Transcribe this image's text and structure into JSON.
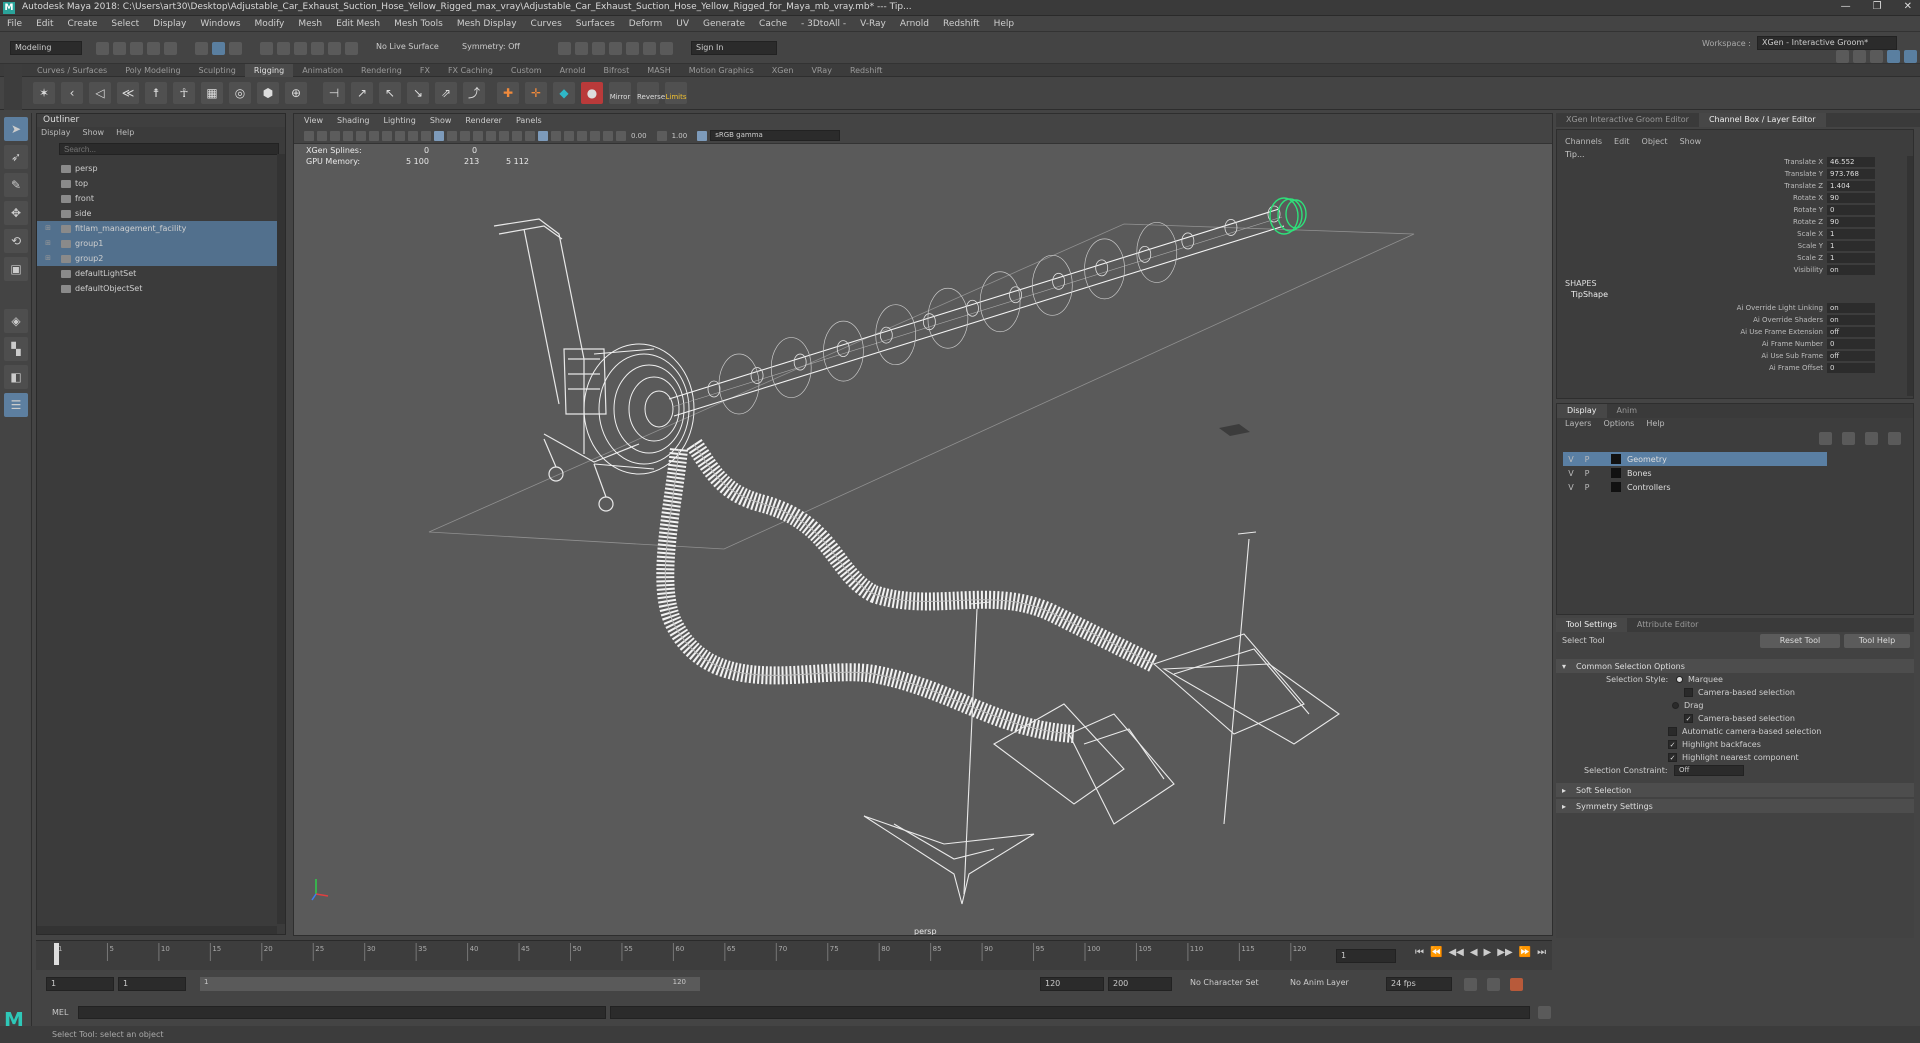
{
  "window": {
    "title": "Autodesk Maya 2018: C:\\Users\\art30\\Desktop\\Adjustable_Car_Exhaust_Suction_Hose_Yellow_Rigged_max_vray\\Adjustable_Car_Exhaust_Suction_Hose_Yellow_Rigged_for_Maya_mb_vray.mb*  ---  Tip...",
    "controls": [
      "—",
      "❐",
      "✕"
    ]
  },
  "menubar": [
    "File",
    "Edit",
    "Create",
    "Select",
    "Display",
    "Windows",
    "Modify",
    "Mesh",
    "Edit Mesh",
    "Mesh Tools",
    "Mesh Display",
    "Curves",
    "Surfaces",
    "Deform",
    "UV",
    "Generate",
    "Cache",
    "- 3DtoAll -",
    "V-Ray",
    "Arnold",
    "Redshift",
    "Help"
  ],
  "status": {
    "mode": "Modeling",
    "live_surface": "No Live Surface",
    "symmetry": "Symmetry: Off",
    "sign_in": "Sign In",
    "workspace_label": "Workspace :",
    "workspace": "XGen - Interactive Groom*"
  },
  "shelf_tabs": [
    "Curves / Surfaces",
    "Poly Modeling",
    "Sculpting",
    "Rigging",
    "Animation",
    "Rendering",
    "FX",
    "FX Caching",
    "Custom",
    "Arnold",
    "Bifrost",
    "MASH",
    "Motion Graphics",
    "XGen",
    "VRay",
    "Redshift"
  ],
  "shelf_active": "Rigging",
  "shelf_labels": {
    "mirror": "Mirror",
    "reverse": "Reverse",
    "limits": "Limits"
  },
  "outliner": {
    "title": "Outliner",
    "menu": [
      "Display",
      "Show",
      "Help"
    ],
    "search_placeholder": "Search...",
    "items": [
      {
        "label": "persp",
        "selected": false,
        "expand": ""
      },
      {
        "label": "top",
        "selected": false,
        "expand": ""
      },
      {
        "label": "front",
        "selected": false,
        "expand": ""
      },
      {
        "label": "side",
        "selected": false,
        "expand": ""
      },
      {
        "label": "fitlam_management_facility",
        "selected": true,
        "expand": "⊞"
      },
      {
        "label": "group1",
        "selected": true,
        "expand": "⊞"
      },
      {
        "label": "group2",
        "selected": true,
        "expand": "⊞"
      },
      {
        "label": "defaultLightSet",
        "selected": false,
        "expand": ""
      },
      {
        "label": "defaultObjectSet",
        "selected": false,
        "expand": ""
      }
    ]
  },
  "viewport": {
    "menu": [
      "View",
      "Shading",
      "Lighting",
      "Show",
      "Renderer",
      "Panels"
    ],
    "exposure": "0.00",
    "gamma": "1.00",
    "color_space": "sRGB gamma",
    "hud": {
      "xgen_label": "XGen Splines:",
      "xgen_a": "0",
      "xgen_b": "0",
      "gpu_label": "GPU Memory:",
      "gpu_a": "5 100",
      "gpu_b": "213",
      "gpu_c": "5 112"
    },
    "camera": "persp"
  },
  "right_tabs": [
    "XGen Interactive Groom Editor",
    "Channel Box / Layer Editor"
  ],
  "channel_box": {
    "menu": [
      "Channels",
      "Edit",
      "Object",
      "Show"
    ],
    "object": "Tip...",
    "attrs": [
      {
        "name": "Translate X",
        "value": "46.552"
      },
      {
        "name": "Translate Y",
        "value": "973.768"
      },
      {
        "name": "Translate Z",
        "value": "1.404"
      },
      {
        "name": "Rotate X",
        "value": "90"
      },
      {
        "name": "Rotate Y",
        "value": "0"
      },
      {
        "name": "Rotate Z",
        "value": "90"
      },
      {
        "name": "Scale X",
        "value": "1"
      },
      {
        "name": "Scale Y",
        "value": "1"
      },
      {
        "name": "Scale Z",
        "value": "1"
      },
      {
        "name": "Visibility",
        "value": "on"
      }
    ],
    "shapes_label": "SHAPES",
    "shape_name": "TipShape",
    "shape_attrs": [
      {
        "name": "Ai Override Light Linking",
        "value": "on"
      },
      {
        "name": "Ai Override Shaders",
        "value": "on"
      },
      {
        "name": "Ai Use Frame Extension",
        "value": "off"
      },
      {
        "name": "Ai Frame Number",
        "value": "0"
      },
      {
        "name": "Ai Use Sub Frame",
        "value": "off"
      },
      {
        "name": "Ai Frame Offset",
        "value": "0"
      }
    ]
  },
  "layer_editor": {
    "tabs": [
      "Display",
      "Anim"
    ],
    "menu": [
      "Layers",
      "Options",
      "Help"
    ],
    "layers": [
      {
        "v": "V",
        "p": "P",
        "name": "Geometry",
        "selected": true
      },
      {
        "v": "V",
        "p": "P",
        "name": "Bones",
        "selected": false
      },
      {
        "v": "V",
        "p": "P",
        "name": "Controllers",
        "selected": false
      }
    ]
  },
  "tool_settings": {
    "tabs": [
      "Tool Settings",
      "Attribute Editor"
    ],
    "tool": "Select Tool",
    "reset": "Reset Tool",
    "help": "Tool Help",
    "section": "Common Selection Options",
    "selection_style_label": "Selection Style:",
    "marquee": "Marquee",
    "camera_based_1": "Camera-based selection",
    "drag": "Drag",
    "camera_based_2": "Camera-based selection",
    "auto_camera": "Automatic camera-based selection",
    "highlight_backfaces": "Highlight backfaces",
    "highlight_nearest": "Highlight nearest component",
    "constraint_label": "Selection Constraint:",
    "constraint_value": "Off",
    "soft": "Soft Selection",
    "symmetry": "Symmetry Settings"
  },
  "timeline": {
    "ticks": [
      "1",
      "5",
      "10",
      "15",
      "20",
      "25",
      "30",
      "35",
      "40",
      "45",
      "50",
      "55",
      "60",
      "65",
      "70",
      "75",
      "80",
      "85",
      "90",
      "95",
      "100",
      "105",
      "110",
      "115",
      "120"
    ],
    "current": "1",
    "playback_icons": [
      "⏮",
      "⏪",
      "◀◀",
      "◀",
      "▶",
      "▶▶",
      "⏩",
      "⏭"
    ]
  },
  "range": {
    "start": "1",
    "start2": "1",
    "slider_start": "1",
    "slider_end": "120",
    "end": "120",
    "max": "200",
    "character": "No Character Set",
    "anim_layer": "No Anim Layer",
    "fps": "24 fps"
  },
  "cmd": {
    "label": "MEL"
  },
  "help_line": "Select Tool: select an object",
  "colors": {
    "accent": "#5a7fa3",
    "viewport": "#5a5a5a",
    "controller": "#2ee07a"
  }
}
